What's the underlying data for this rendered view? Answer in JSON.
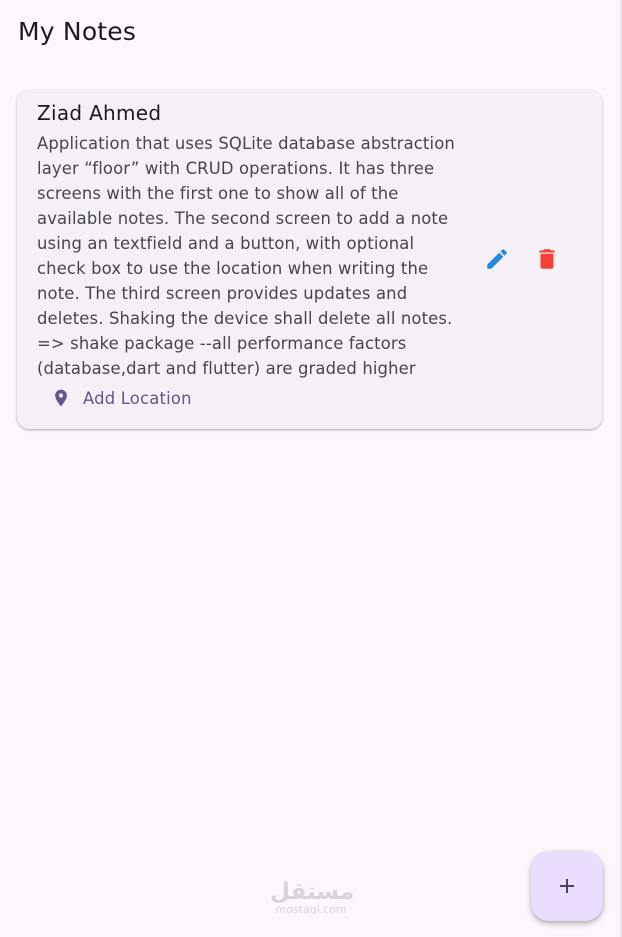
{
  "appbar": {
    "title": "My Notes"
  },
  "notes": [
    {
      "title": "Ziad Ahmed",
      "body": "Application that uses SQLite database abstraction layer “floor” with CRUD operations. It has three screens with the first one to show all of the available notes. The second screen to add a note using an textfield and a button, with optional check box to use the location when writing the note. The third screen provides updates and deletes. Shaking the device shall delete all notes. => shake package --all performance factors (database,dart and flutter) are graded higher",
      "location_label": "Add Location",
      "edit_icon": "pencil-icon",
      "delete_icon": "trash-icon",
      "location_icon": "location-pin-icon"
    }
  ],
  "fab": {
    "icon": "plus-icon"
  },
  "watermark": {
    "logo": "مستقل",
    "sub": "mostaql.com"
  },
  "colors": {
    "background": "#fdf7fd",
    "card": "#f5f0f6",
    "edit": "#1e88e5",
    "delete": "#f44336",
    "accent": "#65558f",
    "fab": "#eaddff"
  }
}
